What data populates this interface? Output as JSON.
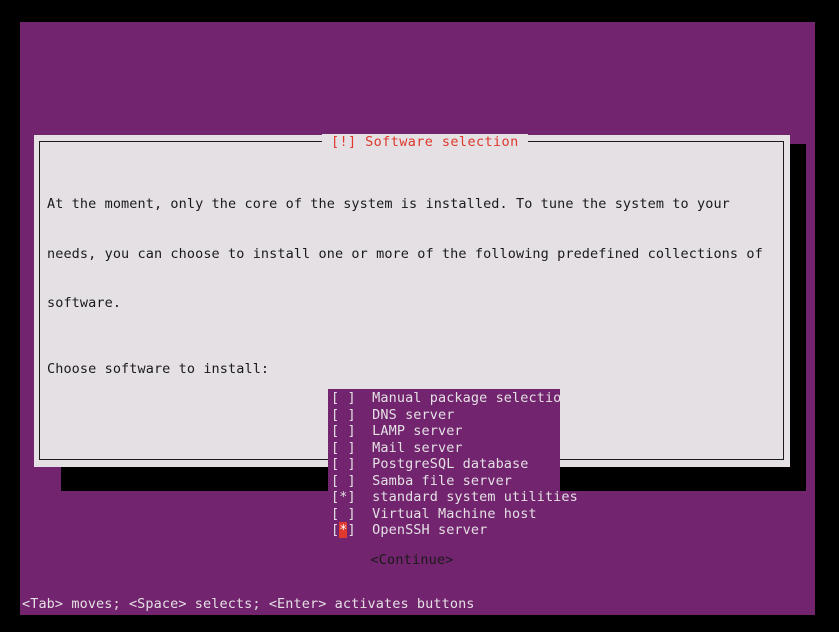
{
  "colors": {
    "backdrop_purple": "#72246e",
    "dialog_bg": "#e4e0e4",
    "text_dark": "#1a1a1a",
    "title_red": "#df382c",
    "list_text": "#e4e0e4",
    "marker_red": "#df382c",
    "shadow_black": "#000000"
  },
  "dialog": {
    "title": "[!] Software selection",
    "body": {
      "paragraph_lines": [
        "At the moment, only the core of the system is installed. To tune the system to your",
        "needs, you can choose to install one or more of the following predefined collections of",
        "software."
      ],
      "prompt": "Choose software to install:"
    },
    "list": {
      "items": [
        {
          "checkbox": "[ ]",
          "checked": false,
          "label": "Manual package selection",
          "cursor": false
        },
        {
          "checkbox": "[ ]",
          "checked": false,
          "label": "DNS server",
          "cursor": false
        },
        {
          "checkbox": "[ ]",
          "checked": false,
          "label": "LAMP server",
          "cursor": false
        },
        {
          "checkbox": "[ ]",
          "checked": false,
          "label": "Mail server",
          "cursor": false
        },
        {
          "checkbox": "[ ]",
          "checked": false,
          "label": "PostgreSQL database",
          "cursor": false
        },
        {
          "checkbox": "[ ]",
          "checked": false,
          "label": "Samba file server",
          "cursor": false
        },
        {
          "checkbox": "[*]",
          "checked": true,
          "label": "standard system utilities",
          "cursor": false
        },
        {
          "checkbox": "[ ]",
          "checked": false,
          "label": "Virtual Machine host",
          "cursor": false
        },
        {
          "checkbox": "[*]",
          "checked": true,
          "label": "OpenSSH server",
          "cursor": true
        }
      ]
    },
    "continue_button": "<Continue>"
  },
  "statusbar": {
    "hint": "<Tab> moves; <Space> selects; <Enter> activates buttons"
  }
}
